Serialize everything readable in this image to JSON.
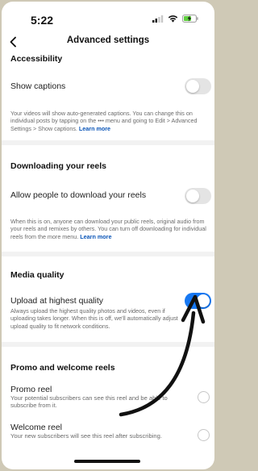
{
  "status": {
    "time": "5:22"
  },
  "nav": {
    "title": "Advanced settings"
  },
  "accessibility": {
    "title": "Accessibility",
    "captions_label": "Show captions",
    "captions_desc": "Your videos will show auto-generated captions. You can change this on individual posts by tapping on the  •••  menu and going to Edit > Advanced Settings > Show captions.",
    "captions_link": "Learn more",
    "captions_enabled": false
  },
  "downloading": {
    "title": "Downloading your reels",
    "allow_label": "Allow people to download your reels",
    "allow_desc": "When this is on, anyone can download your public reels, original audio from your reels and remixes by others. You can turn off downloading for individual reels from the more menu.",
    "allow_link": "Learn more",
    "allow_enabled": false
  },
  "media_quality": {
    "title": "Media quality",
    "upload_label": "Upload at highest quality",
    "upload_desc": "Always upload the highest quality photos and videos, even if uploading takes longer. When this is off, we'll automatically adjust upload quality to fit network conditions.",
    "upload_enabled": true
  },
  "promo": {
    "title": "Promo and welcome reels",
    "promo_label": "Promo reel",
    "promo_desc": "Your potential subscribers can see this reel and be able to subscribe from it.",
    "welcome_label": "Welcome reel",
    "welcome_desc": "Your new subscribers will see this reel after subscribing."
  },
  "colors": {
    "toggle_on": "#1778f2",
    "link": "#0a55b8"
  }
}
